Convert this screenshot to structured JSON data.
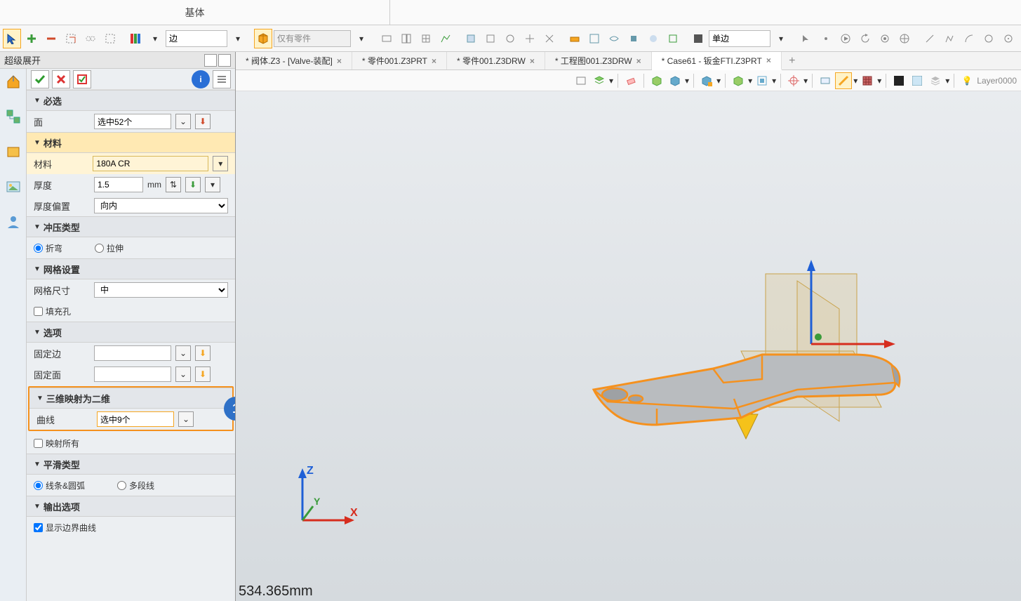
{
  "ribbon": {
    "tab": "基体"
  },
  "toolbar": {
    "filter_select": "边",
    "scope_select": "仅有零件",
    "edge_mode": "单边"
  },
  "panel": {
    "title": "超级展开",
    "sections": {
      "required": {
        "title": "必选",
        "face_label": "面",
        "face_value": "选中52个"
      },
      "material": {
        "title": "材料",
        "material_label": "材料",
        "material_value": "180A CR",
        "thickness_label": "厚度",
        "thickness_value": "1.5",
        "thickness_unit": "mm",
        "offset_label": "厚度偏置",
        "offset_value": "向内"
      },
      "press_type": {
        "title": "冲压类型",
        "opt_bend": "折弯",
        "opt_stretch": "拉伸"
      },
      "mesh": {
        "title": "网格设置",
        "size_label": "网格尺寸",
        "size_value": "中",
        "fill_holes": "填充孔"
      },
      "options": {
        "title": "选项",
        "fixed_edge": "固定边",
        "fixed_face": "固定面"
      },
      "map3d2d": {
        "title": "三维映射为二维",
        "curve_label": "曲线",
        "curve_value": "选中9个",
        "map_all": "映射所有"
      },
      "smooth": {
        "title": "平滑类型",
        "opt_arc": "线条&圆弧",
        "opt_poly": "多段线"
      },
      "output": {
        "title": "输出选项",
        "show_boundary": "显示边界曲线"
      }
    },
    "step_badge": "1"
  },
  "tabs": [
    {
      "label": "* 阀体.Z3 - [Valve-装配]",
      "active": false
    },
    {
      "label": "* 零件001.Z3PRT",
      "active": false
    },
    {
      "label": "* 零件001.Z3DRW",
      "active": false
    },
    {
      "label": "* 工程图001.Z3DRW",
      "active": false
    },
    {
      "label": "* Case61 - 钣金FTI.Z3PRT",
      "active": true
    }
  ],
  "viewport": {
    "axis_x": "X",
    "axis_y": "Y",
    "axis_z": "Z",
    "status_mm": "534.365mm"
  },
  "layer": {
    "name": "Layer0000"
  }
}
